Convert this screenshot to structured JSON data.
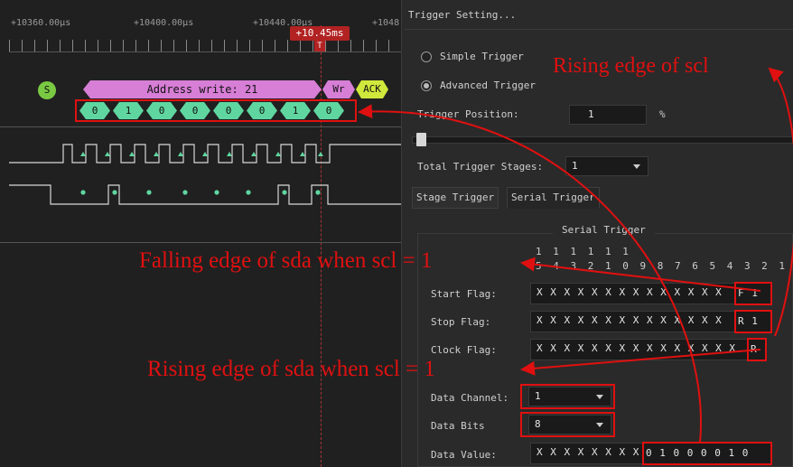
{
  "timeline": {
    "ticks": [
      "+10360.00µs",
      "+10400.00µs",
      "+10440.00µs",
      "+1048"
    ],
    "marker": "+10.45ms",
    "marker_tag": "T"
  },
  "decoder": {
    "start": "S",
    "address": "Address write: 21",
    "rw": "Wr",
    "ack": "ACK",
    "bits": [
      "0",
      "1",
      "0",
      "0",
      "0",
      "0",
      "1",
      "0"
    ]
  },
  "panel": {
    "title": "Trigger Setting...",
    "simple_trigger": "Simple Trigger",
    "advanced_trigger": "Advanced Trigger",
    "trigger_position_label": "Trigger Position:",
    "trigger_position_value": "1",
    "percent": "%",
    "trigger_position_fraction": 0.01,
    "total_stages_label": "Total Trigger Stages:",
    "total_stages_value": "1",
    "tab_stage": "Stage Trigger",
    "tab_serial": "Serial Trigger",
    "group_title": "Serial Trigger",
    "bit_numbers_top": "1 1 1 1 1 1",
    "bit_numbers_bottom": "5 4 3 2 1 0 9 8 7 6 5 4 3 2 1 0",
    "start_flag_label": "Start Flag:",
    "start_flag_mask": "X X X X X X X X X X X X X X",
    "start_flag_bits": "F 1",
    "stop_flag_label": "Stop Flag:",
    "stop_flag_mask": "X X X X X X X X X X X X X X",
    "stop_flag_bits": "R 1",
    "clock_flag_label": "Clock Flag:",
    "clock_flag_mask": "X X X X X X X X X X X X X X X",
    "clock_flag_bits": "R",
    "data_channel_label": "Data Channel:",
    "data_channel_value": "1",
    "data_bits_label": "Data Bits",
    "data_bits_value": "8",
    "data_value_label": "Data Value:",
    "data_value_mask": "X X X X X X X X",
    "data_value_bits": "0 1 0 0 0 0 1 0"
  },
  "annotations": {
    "rising_scl": "Rising edge of scl",
    "falling_sda": "Falling edge of sda when scl = 1",
    "rising_sda": "Rising edge of sda when scl = 1"
  },
  "colors": {
    "annotation_red": "#e01010",
    "address_pink": "#d77ed6",
    "bit_green": "#5fd6a0",
    "ack_yellow": "#cfe83c",
    "start_green": "#7ac943",
    "marker_red": "#b22222"
  }
}
